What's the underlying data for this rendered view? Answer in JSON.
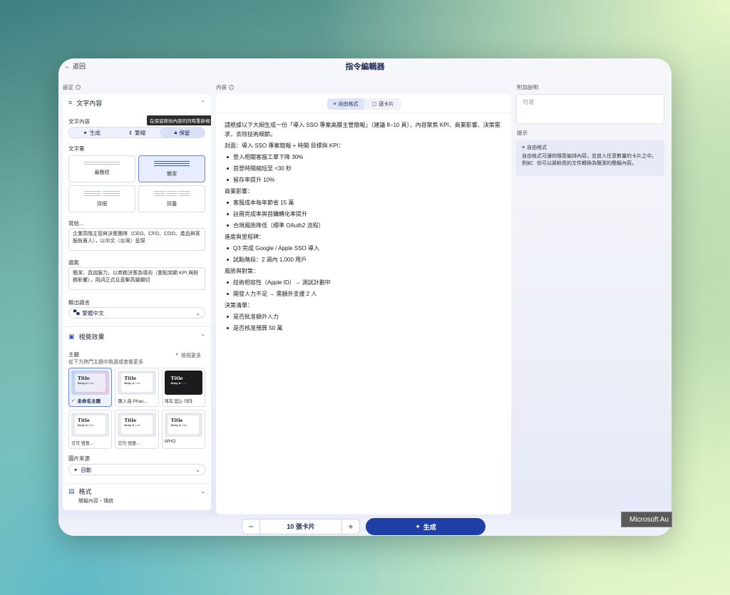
{
  "header": {
    "back_label": "返回",
    "title": "指令編輯器"
  },
  "sections": {
    "settings": "設定",
    "content": "內容",
    "notes": "附加說明",
    "hint": "提示"
  },
  "text_card": {
    "title": "文字內容",
    "text_content_label": "文字內容",
    "modes": [
      "生成",
      "繁縮",
      "保留"
    ],
    "selected_mode": "保留",
    "tooltip": "在保留原始內容的同時重新格式化",
    "amount_label": "文字量",
    "amounts": [
      "最簡短",
      "簡潔",
      "詳細",
      "詳盡"
    ],
    "selected_amount": "簡潔",
    "audience_label": "寫給...",
    "audience_value": "企業高階主管與決策團隊（CEO、CFO、COO、產品與客服負責人），以中文（台灣）呈現",
    "tone_label": "語氣",
    "tone_value": "簡潔、具說服力，以商務決策為導向（重點突顯 KPI 與財務影響），用詞正式且直擊高層關切",
    "output_lang_label": "輸出語言",
    "output_lang_value": "繁體中文"
  },
  "visual_card": {
    "title": "視覺效果",
    "theme_label": "主題",
    "theme_sub": "從下方熱門主題中挑選或查看更多",
    "see_more": "檢視更多",
    "themes": [
      {
        "name": "未命名主題",
        "title": "Title",
        "body": "Body &",
        "link": "Link"
      },
      {
        "name": "匯入自 Phas...",
        "title": "Title",
        "body": "Body &",
        "link": "Link"
      },
      {
        "name": "제목 없는 테마",
        "title": "Title",
        "body": "Body &",
        "link": "Link"
      },
      {
        "name": "강의 템플...",
        "title": "Title",
        "body": "Body &",
        "link": "Link"
      },
      {
        "name": "강의 템플...",
        "title": "Title",
        "body": "Body &",
        "link": "Link"
      },
      {
        "name": "WHO",
        "title": "Title",
        "body": "Body &",
        "link": "Link"
      }
    ],
    "image_source_label": "圖片來源",
    "image_source_value": "自動"
  },
  "format_card": {
    "title": "格式",
    "sub": "簡報內容・傳統"
  },
  "content_tabs": [
    "自由格式",
    "逐卡片"
  ],
  "content": {
    "intro": "請根據以下大綱生成一份「導入 SSO 專案高層主管簡報」（建議 8–10 頁），內容聚焦 KPI、商業影響、決策需求，去除技術細節。",
    "groups": [
      {
        "heading": "封面：導入 SSO 專案簡報 + 時間 目標與 KPI：",
        "items": [
          "登入相關客服工單下降 30%",
          "首登時間縮短至 <30 秒",
          "留存率提升 10%"
        ]
      },
      {
        "heading": "商業影響：",
        "items": [
          "客服成本每年節省 15 萬",
          "註冊完成率與首購轉化率提升",
          "合規風險降低（標準 OAuth2 流程）"
        ]
      },
      {
        "heading": "進度與里程碑：",
        "items": [
          "Q3 完成 Google / Apple SSO 導入",
          "試點階段：2 週內 1,000 用戶"
        ]
      },
      {
        "heading": "風險與對策：",
        "items": [
          "技術相容性（Apple ID）→ 測試計劃中",
          "開發人力不足 → 需額外支援 2 人"
        ]
      },
      {
        "heading": "決策清單：",
        "items": [
          "是否批准額外人力",
          "是否核准預算 50 萬"
        ]
      }
    ]
  },
  "notes_placeholder": "可選",
  "hint": {
    "title": "自由格式",
    "body": "自由格式可讓你隨意編排內容，並放入任意數量的卡片之中。例如：你可以將較長的文件轉換為簡潔的簡報內容。"
  },
  "footer": {
    "minus": "−",
    "card_count": "10 張卡片",
    "plus": "+",
    "generate": "生成"
  },
  "taskbar_tooltip": "Microsoft Au",
  "colors": {
    "accent": "#1f3fa6",
    "selected_bg": "#e7edfd"
  }
}
